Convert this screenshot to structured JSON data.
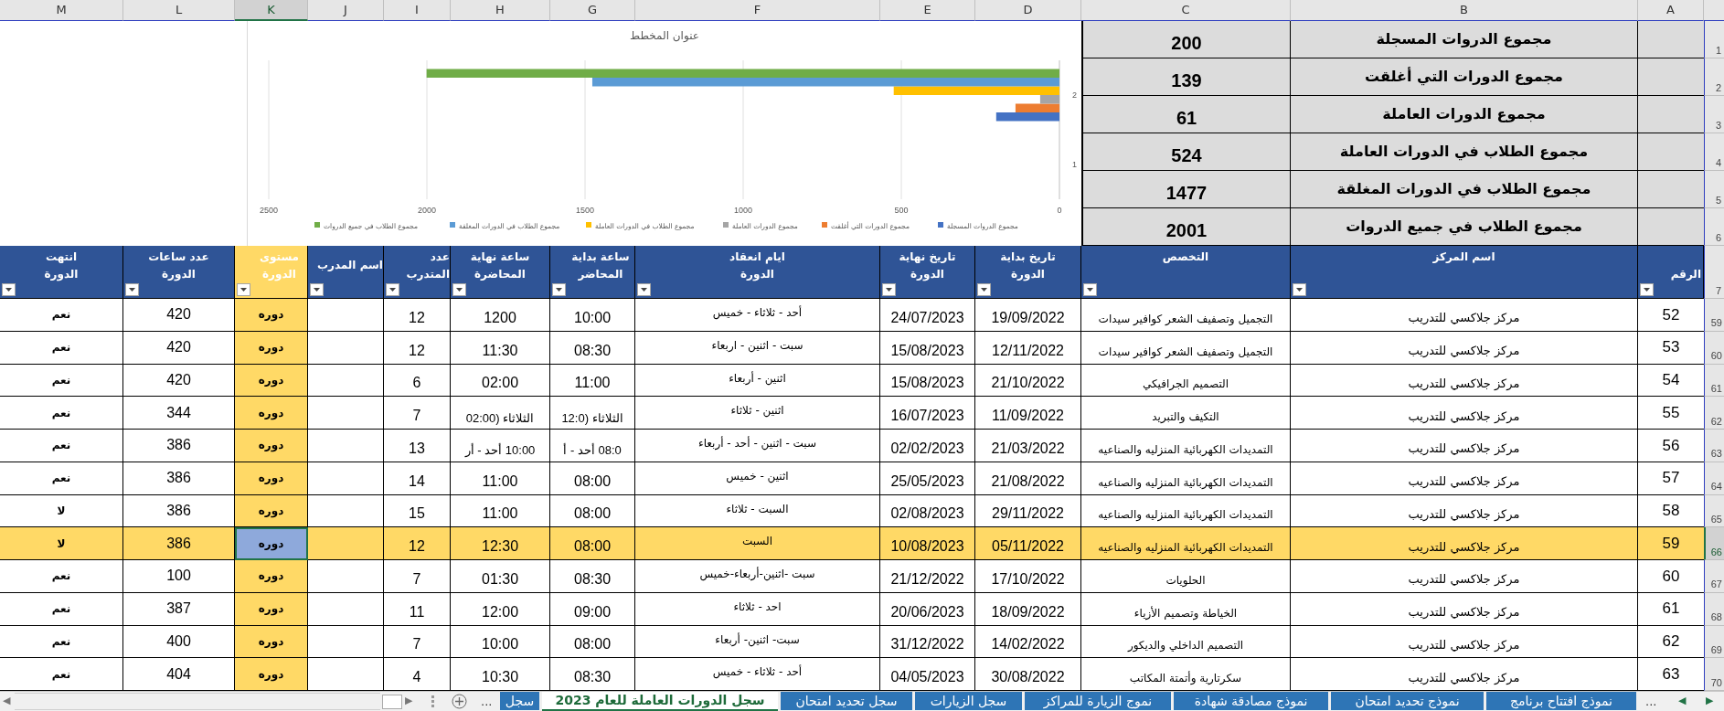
{
  "column_letters": [
    {
      "label": "A",
      "selected": false
    },
    {
      "label": "B",
      "selected": false
    },
    {
      "label": "C",
      "selected": false
    },
    {
      "label": "D",
      "selected": false
    },
    {
      "label": "E",
      "selected": false
    },
    {
      "label": "F",
      "selected": false
    },
    {
      "label": "G",
      "selected": false
    },
    {
      "label": "H",
      "selected": false
    },
    {
      "label": "I",
      "selected": false
    },
    {
      "label": "J",
      "selected": false
    },
    {
      "label": "K",
      "selected": true
    },
    {
      "label": "L",
      "selected": false
    },
    {
      "label": "M",
      "selected": false
    }
  ],
  "summary": [
    {
      "row_number": "1",
      "label": "مجموع  الدروات المسجلة",
      "value": "200"
    },
    {
      "row_number": "2",
      "label": "مجموع الدورات التي أغلقت",
      "value": "139"
    },
    {
      "row_number": "3",
      "label": "مجموع الدورات العاملة",
      "value": "61"
    },
    {
      "row_number": "4",
      "label": "مجموع الطلاب في الدورات العاملة",
      "value": "524"
    },
    {
      "row_number": "5",
      "label": "مجموع الطلاب في الدورات المغلقة",
      "value": "1477"
    },
    {
      "row_number": "6",
      "label": "مجموع الطلاب في جميع الدروات",
      "value": "2001"
    }
  ],
  "chart_data": {
    "type": "bar",
    "orientation": "horizontal",
    "title": "عنوان المخطط",
    "categories": [
      "2",
      "1"
    ],
    "xlim": [
      2500,
      0
    ],
    "xticks": [
      2500,
      2000,
      1500,
      1000,
      500,
      0
    ],
    "grid": true,
    "legend": "bottom",
    "series": [
      {
        "name": "مجموع  الدروات المسجلة",
        "color": "#4472c4",
        "values": [
          200,
          null
        ]
      },
      {
        "name": "مجموع الدورات التي أغلقت",
        "color": "#ed7d31",
        "values": [
          139,
          null
        ]
      },
      {
        "name": "مجموع الدورات العاملة",
        "color": "#a5a5a5",
        "values": [
          61,
          null
        ]
      },
      {
        "name": "مجموع الطلاب في الدورات العاملة",
        "color": "#ffc000",
        "values": [
          524,
          null
        ]
      },
      {
        "name": "مجموع الطلاب في الدورات المغلقة",
        "color": "#5b9bd5",
        "values": [
          1477,
          null
        ]
      },
      {
        "name": "مجموع الطلاب في جميع الدروات",
        "color": "#70ad47",
        "values": [
          2001,
          null
        ]
      }
    ]
  },
  "table": {
    "header_row_number": "7",
    "columns": [
      {
        "title": "الرقم",
        "highlighted": false
      },
      {
        "title": "اسم المركز",
        "highlighted": false
      },
      {
        "title": "التخصص",
        "highlighted": false
      },
      {
        "title": "تاريخ بداية\nالدورة",
        "highlighted": false
      },
      {
        "title": "تاريخ نهاية\nالدورة",
        "highlighted": false
      },
      {
        "title": "ايام انعقاد\nالدورة",
        "highlighted": false
      },
      {
        "title": "ساعة بداية\nالمحاضر",
        "highlighted": false
      },
      {
        "title": "ساعة نهاية\nالمحاضرة",
        "highlighted": false
      },
      {
        "title": "عدد\nالمتدرب",
        "highlighted": false
      },
      {
        "title": "اسم المدرب",
        "highlighted": false
      },
      {
        "title": "مستوى\nالدورة",
        "highlighted": true
      },
      {
        "title": "عدد ساعات\nالدورة",
        "highlighted": false
      },
      {
        "title": "انتهت\nالدورة",
        "highlighted": false
      }
    ],
    "rows": [
      {
        "row_number": "59",
        "selected": false,
        "level_cell_selected": false,
        "num": "52",
        "center": "مركز جلاكسي للتدريب",
        "specialty": "التجميل وتصفيف الشعر كوافير سيدات",
        "start_date": "19/09/2022",
        "end_date": "24/07/2023",
        "days": "أحد - ثلاثاء - خميس",
        "start_time": "10:00",
        "end_time": "1200",
        "trainees": "12",
        "level": "دوره",
        "hours": "420",
        "ended": "نعم"
      },
      {
        "row_number": "60",
        "selected": false,
        "level_cell_selected": false,
        "num": "53",
        "center": "مركز جلاكسي للتدريب",
        "specialty": "التجميل وتصفيف الشعر كوافير سيدات",
        "start_date": "12/11/2022",
        "end_date": "15/08/2023",
        "days": "سبت - اثنين - اربعاء",
        "start_time": "08:30",
        "end_time": "11:30",
        "trainees": "12",
        "level": "دوره",
        "hours": "420",
        "ended": "نعم"
      },
      {
        "row_number": "61",
        "selected": false,
        "level_cell_selected": false,
        "num": "54",
        "center": "مركز جلاكسي للتدريب",
        "specialty": "التصميم الجرافيكي",
        "start_date": "21/10/2022",
        "end_date": "15/08/2023",
        "days": "اثنين - أربعاء",
        "start_time": "11:00",
        "end_time": "02:00",
        "trainees": "6",
        "level": "دوره",
        "hours": "420",
        "ended": "نعم"
      },
      {
        "row_number": "62",
        "selected": false,
        "level_cell_selected": false,
        "num": "55",
        "center": "مركز جلاكسي للتدريب",
        "specialty": "التكيف والتبريد",
        "start_date": "11/09/2022",
        "end_date": "16/07/2023",
        "days": "اثنين - ثلاثاء",
        "start_time": "الثلاثاء (12:0",
        "end_time": "الثلاثاء (02:00",
        "trainees": "7",
        "level": "دوره",
        "hours": "344",
        "ended": "نعم"
      },
      {
        "row_number": "63",
        "selected": false,
        "level_cell_selected": false,
        "num": "56",
        "center": "مركز جلاكسي للتدريب",
        "specialty": "التمديدات الكهربائية المنزليه والصناعيه",
        "start_date": "21/03/2022",
        "end_date": "02/02/2023",
        "days": "سبت - اثنين - أحد - أربعاء",
        "start_time": "08:0 أحد - أ",
        "end_time": "10:00 أحد - أر",
        "trainees": "13",
        "level": "دوره",
        "hours": "386",
        "ended": "نعم"
      },
      {
        "row_number": "64",
        "selected": false,
        "level_cell_selected": false,
        "num": "57",
        "center": "مركز جلاكسي للتدريب",
        "specialty": "التمديدات الكهربائية المنزليه والصناعيه",
        "start_date": "21/08/2022",
        "end_date": "25/05/2023",
        "days": "اثنين - خميس",
        "start_time": "08:00",
        "end_time": "11:00",
        "trainees": "14",
        "level": "دوره",
        "hours": "386",
        "ended": "نعم"
      },
      {
        "row_number": "65",
        "selected": false,
        "level_cell_selected": false,
        "num": "58",
        "center": "مركز جلاكسي للتدريب",
        "specialty": "التمديدات الكهربائية المنزليه والصناعيه",
        "start_date": "29/11/2022",
        "end_date": "02/08/2023",
        "days": "السبت - ثلاثاء",
        "start_time": "08:00",
        "end_time": "11:00",
        "trainees": "15",
        "level": "دوره",
        "hours": "386",
        "ended": "لا"
      },
      {
        "row_number": "66",
        "selected": true,
        "level_cell_selected": true,
        "num": "59",
        "center": "مركز جلاكسي للتدريب",
        "specialty": "التمديدات الكهربائية المنزليه والصناعيه",
        "start_date": "05/11/2022",
        "end_date": "10/08/2023",
        "days": "السبت",
        "start_time": "08:00",
        "end_time": "12:30",
        "trainees": "12",
        "level": "دوره",
        "hours": "386",
        "ended": "لا"
      },
      {
        "row_number": "67",
        "selected": false,
        "level_cell_selected": false,
        "num": "60",
        "center": "مركز جلاكسي للتدريب",
        "specialty": "الحلويات",
        "start_date": "17/10/2022",
        "end_date": "21/12/2022",
        "days": "سبت -اثنين-أربعاء-خميس",
        "start_time": "08:30",
        "end_time": "01:30",
        "trainees": "7",
        "level": "دوره",
        "hours": "100",
        "ended": "نعم"
      },
      {
        "row_number": "68",
        "selected": false,
        "level_cell_selected": false,
        "num": "61",
        "center": "مركز جلاكسي للتدريب",
        "specialty": "الخياطة وتصميم الأزياء",
        "start_date": "18/09/2022",
        "end_date": "20/06/2023",
        "days": "احد - ثلاثاء",
        "start_time": "09:00",
        "end_time": "12:00",
        "trainees": "11",
        "level": "دوره",
        "hours": "387",
        "ended": "نعم"
      },
      {
        "row_number": "69",
        "selected": false,
        "level_cell_selected": false,
        "num": "62",
        "center": "مركز جلاكسي للتدريب",
        "specialty": "التصميم الداخلي والديكور",
        "start_date": "14/02/2022",
        "end_date": "31/12/2022",
        "days": "سبت- اثنين- أربعاء",
        "start_time": "08:00",
        "end_time": "10:00",
        "trainees": "7",
        "level": "دوره",
        "hours": "400",
        "ended": "نعم"
      },
      {
        "row_number": "70",
        "selected": false,
        "level_cell_selected": false,
        "num": "63",
        "center": "مركز جلاكسي للتدريب",
        "specialty": "سكرتارية وأتمتة المكاتب",
        "start_date": "30/08/2022",
        "end_date": "04/05/2023",
        "days": "أحد - ثلاثاء - خميس",
        "start_time": "08:30",
        "end_time": "10:30",
        "trainees": "4",
        "level": "دوره",
        "hours": "404",
        "ended": "نعم"
      }
    ]
  },
  "sheet_tabs": {
    "scroll_left_arrow": "◀",
    "scroll_right_arrow": "▶",
    "left_more": "...",
    "right_more": "...",
    "previous_sheet_arrow": "◀",
    "next_sheet_arrow": "▶",
    "tabs": [
      {
        "label": "نموذج افتتاح برنامج",
        "selected": false
      },
      {
        "label": "نموذج تحديد امتحان",
        "selected": false
      },
      {
        "label": "نموذج مصادقة شهادة",
        "selected": false
      },
      {
        "label": "نموج الزيارة للمراكز",
        "selected": false
      },
      {
        "label": "سجل الزيارات",
        "selected": false
      },
      {
        "label": "سجل تحديد امتحان",
        "selected": false
      },
      {
        "label": "سجل الدورات العاملة للعام 2023",
        "selected": true
      },
      {
        "label": "سجل",
        "selected": false
      }
    ]
  }
}
